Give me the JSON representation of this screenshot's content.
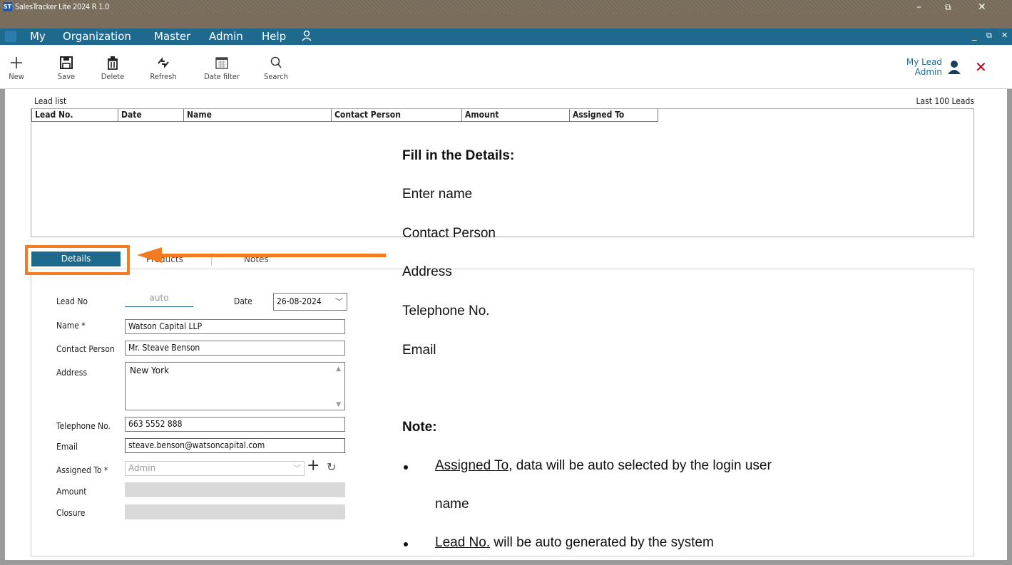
{
  "window": {
    "app_icon": "ST",
    "title": "SalesTracker Lite 2024 R 1.0",
    "minimize": "–",
    "restore": "⧉",
    "close": "✕"
  },
  "menu": {
    "items": [
      "My",
      "Organization",
      "Master",
      "Admin",
      "Help"
    ],
    "mdi_minimize": "_",
    "mdi_restore": "⧉",
    "mdi_close": "✕"
  },
  "toolbar": {
    "new_label": "New",
    "save_label": "Save",
    "delete_label": "Delete",
    "refresh_label": "Refresh",
    "date_filter_label": "Date filter",
    "search_label": "Search"
  },
  "user": {
    "line1": "My Lead",
    "line2": "Admin"
  },
  "lead_list": {
    "title": "Lead list",
    "count_label": "Last 100 Leads",
    "columns": [
      "Lead No.",
      "Date",
      "Name",
      "Contact Person",
      "Amount",
      "Assigned To"
    ]
  },
  "tabs": {
    "details": "Details",
    "products": "Products",
    "notes": "Notes"
  },
  "form": {
    "lead_no_label": "Lead No",
    "lead_no_value": "auto",
    "date_label": "Date",
    "date_value": "26-08-2024",
    "name_label": "Name *",
    "name_value": "Watson Capital LLP",
    "contact_label": "Contact Person",
    "contact_value": "Mr. Steave Benson",
    "address_label": "Address",
    "address_value": "New York",
    "telephone_label": "Telephone No.",
    "telephone_value": "663 5552 888",
    "email_label": "Email",
    "email_value": "steave.benson@watsoncapital.com",
    "assigned_label": "Assigned To *",
    "assigned_value": "Admin",
    "amount_label": "Amount",
    "closure_label": "Closure"
  },
  "annotation": {
    "heading": "Fill in the Details:",
    "items": [
      "Enter name",
      "Contact Person",
      "Address",
      "Telephone No.",
      "Email"
    ],
    "note_heading": "Note:",
    "note1_link": "Assigned To",
    "note1_rest_a": ", data will be auto selected by the login user",
    "note1_rest_b": "name",
    "note2_link": "Lead No.",
    "note2_rest": " will be auto generated by the system"
  },
  "colors": {
    "accent": "#1e6a8e",
    "highlight": "#f47b20",
    "close_red": "#c0001e"
  }
}
